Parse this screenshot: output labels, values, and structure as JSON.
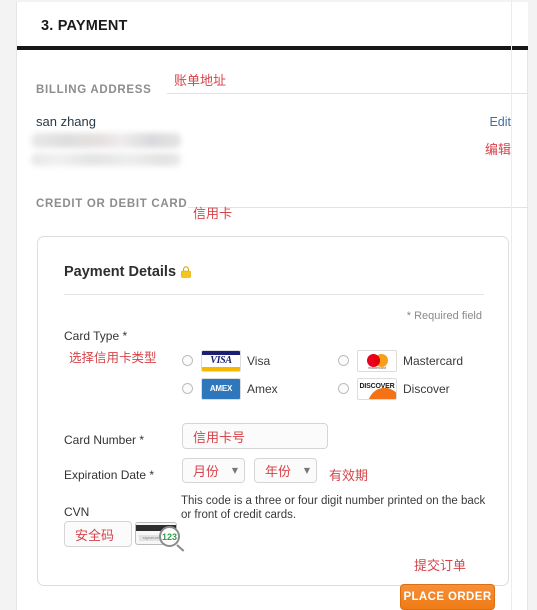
{
  "header": {
    "step_title": "3. PAYMENT"
  },
  "billing": {
    "section_label": "BILLING ADDRESS",
    "section_annotation": "账单地址",
    "name": "san zhang",
    "edit_label": "Edit",
    "edit_annotation": "编辑"
  },
  "card_section": {
    "section_label": "CREDIT OR DEBIT CARD",
    "section_annotation": "信用卡"
  },
  "panel": {
    "title": "Payment Details",
    "lock_icon": "lock-icon",
    "required_note": "* Required field",
    "card_type": {
      "label": "Card Type *",
      "annotation": "选择信用卡类型",
      "options": [
        {
          "label": "Visa",
          "brand": "visa",
          "brand_text": "VISA",
          "selected": false
        },
        {
          "label": "Mastercard",
          "brand": "mastercard",
          "brand_text": "mastercard",
          "selected": false
        },
        {
          "label": "Amex",
          "brand": "amex",
          "brand_text": "AMEX",
          "selected": false
        },
        {
          "label": "Discover",
          "brand": "discover",
          "brand_text": "DISCOVER",
          "selected": false
        }
      ]
    },
    "card_number": {
      "label": "Card Number *",
      "value": "信用卡号"
    },
    "expiration": {
      "label": "Expiration Date *",
      "month_value": "月份",
      "year_value": "年份",
      "annotation": "有效期"
    },
    "cvn": {
      "label": "CVN",
      "value": "安全码",
      "help_text": "This code is a three or four digit number printed on the back or front of credit cards.",
      "magnifier_digits": "123"
    }
  },
  "footer": {
    "place_order_label": "PLACE ORDER",
    "place_order_annotation": "提交订单"
  },
  "colors": {
    "accent_orange": "#ef7b14",
    "link_blue": "#3f6fa8",
    "annotation_red": "#d5444a",
    "header_rule": "#171717"
  }
}
